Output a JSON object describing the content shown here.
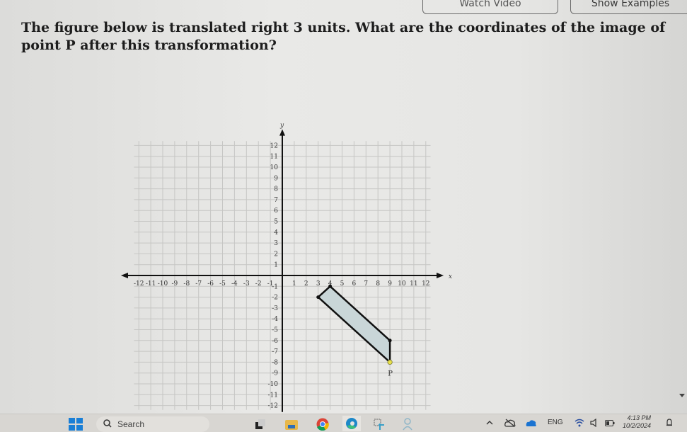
{
  "header": {
    "watch_video_label": "Watch Video",
    "show_examples_label": "Show Examples"
  },
  "question": {
    "text": "The figure below is translated right 3 units. What are the coordinates of the image of point P after this transformation?"
  },
  "chart_data": {
    "type": "scatter",
    "title": "",
    "xlabel": "x",
    "ylabel": "y",
    "xlim": [
      -12,
      12
    ],
    "ylim": [
      -12,
      12
    ],
    "grid": true,
    "x_ticks": [
      -12,
      -11,
      -10,
      -9,
      -8,
      -7,
      -6,
      -5,
      -4,
      -3,
      -2,
      -1,
      1,
      2,
      3,
      4,
      5,
      6,
      7,
      8,
      9,
      10,
      11,
      12
    ],
    "y_ticks": [
      -12,
      -11,
      -10,
      -9,
      -8,
      -7,
      -6,
      -5,
      -4,
      -3,
      -2,
      -1,
      1,
      2,
      3,
      4,
      5,
      6,
      7,
      8,
      9,
      10,
      11,
      12
    ],
    "polygon": {
      "name": "figure",
      "vertices": [
        [
          4,
          -1
        ],
        [
          9,
          -6
        ],
        [
          9,
          -8
        ],
        [
          3,
          -2
        ]
      ],
      "fill": "#c9d6d8",
      "stroke": "#111111"
    },
    "points": [
      {
        "label": "P",
        "x": 9,
        "y": -8,
        "color": "#e8e04a"
      }
    ]
  },
  "taskbar": {
    "search_placeholder": "Search",
    "language": "ENG",
    "time": "4:13 PM",
    "date": "10/2/2024",
    "apps": [
      "windows-start",
      "task-view",
      "file-explorer",
      "chrome",
      "edge",
      "snipping-tool",
      "people"
    ],
    "tray_icons": [
      "chevron-up",
      "cloud-off",
      "onedrive",
      "wifi",
      "volume",
      "battery",
      "notifications"
    ]
  }
}
